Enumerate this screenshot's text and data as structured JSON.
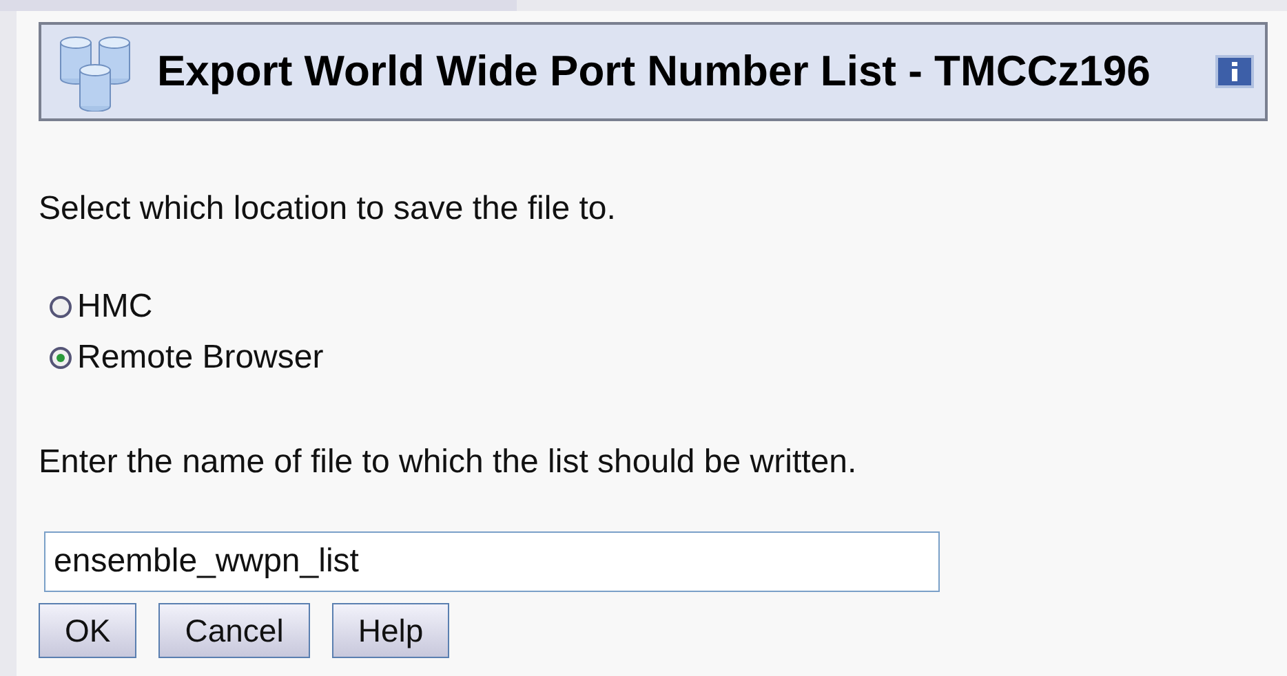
{
  "dialog": {
    "title": "Export World Wide Port Number List - TMCCz196",
    "prompt": "Select which location to save the file to.",
    "locations": [
      {
        "label": "HMC",
        "selected": false
      },
      {
        "label": "Remote Browser",
        "selected": true
      }
    ],
    "file_prompt": "Enter the name of file to which the list should be written.",
    "file_name": {
      "value": "ensemble_wwpn_list"
    },
    "buttons": [
      "OK",
      "Cancel",
      "Help"
    ]
  }
}
